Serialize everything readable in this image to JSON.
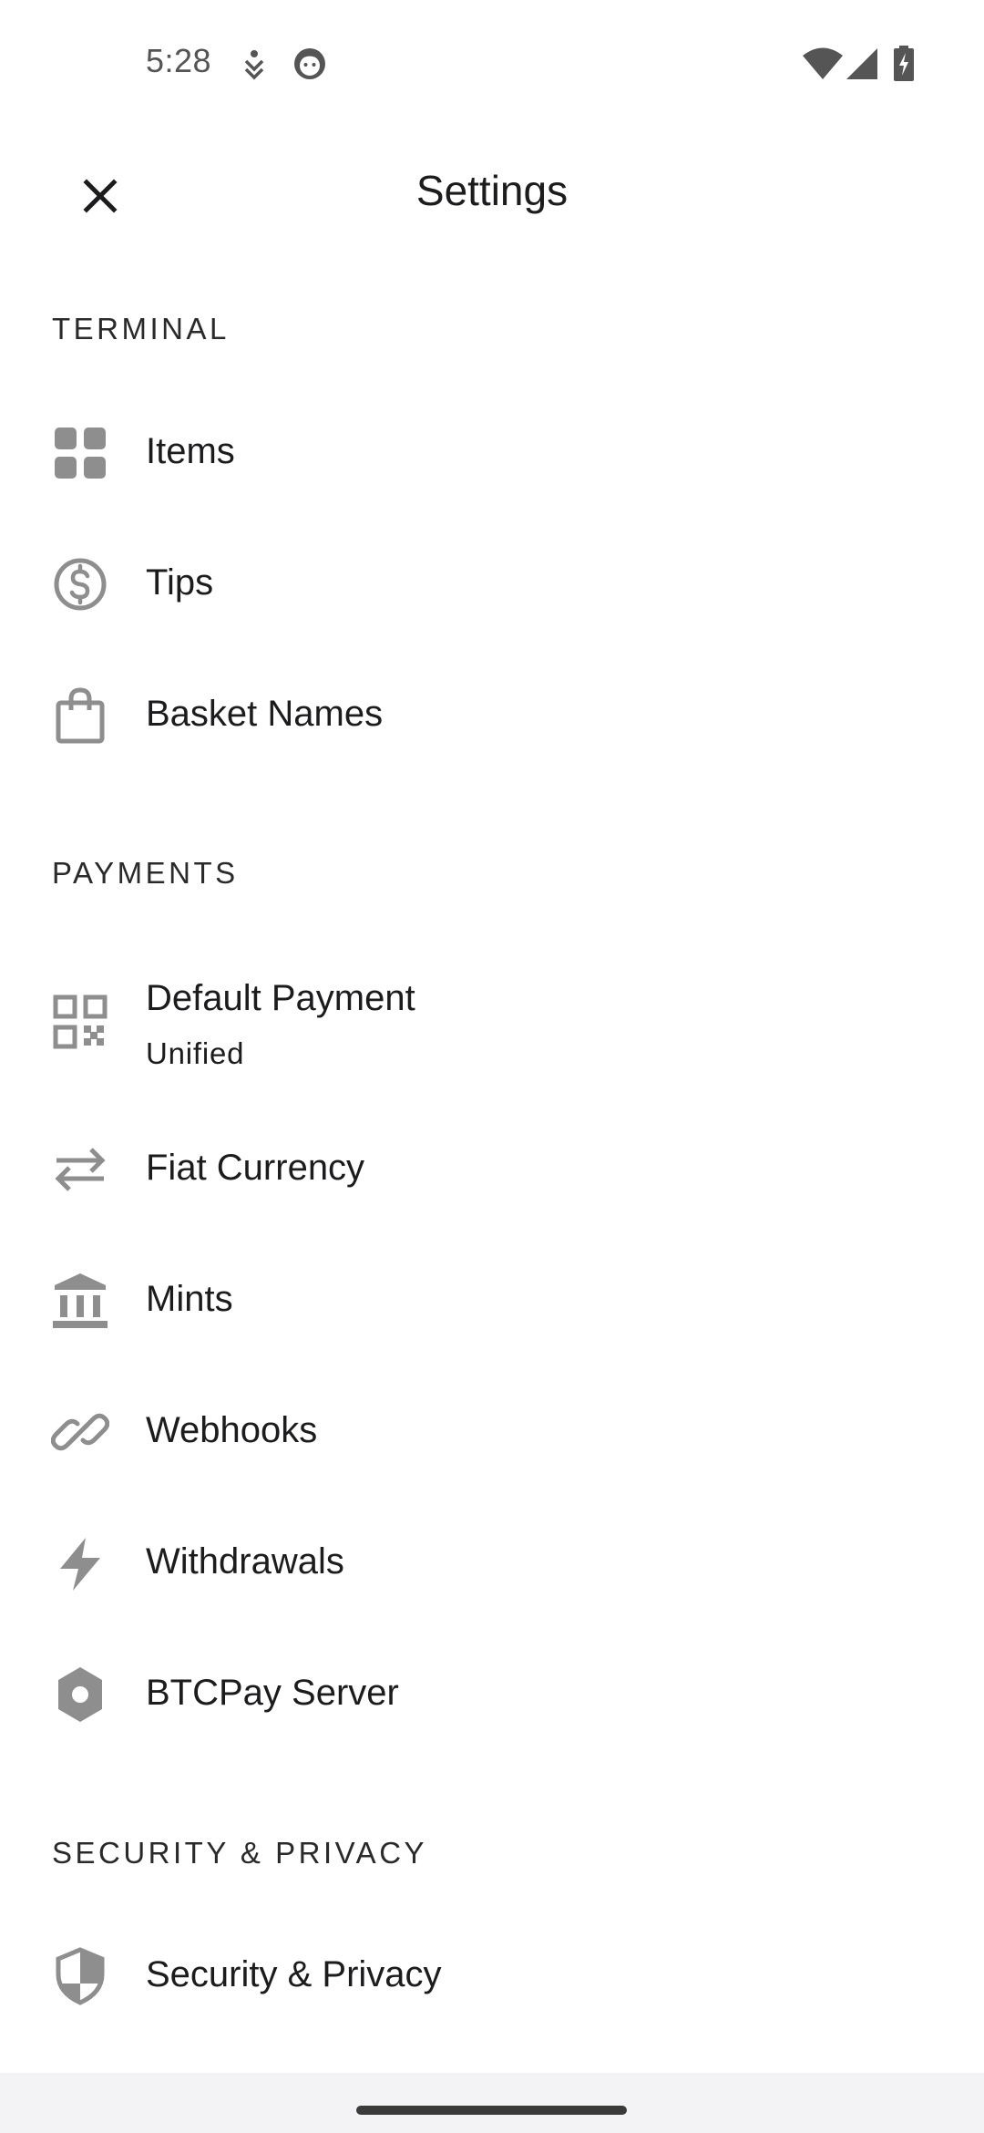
{
  "status_bar": {
    "time": "5:28",
    "icons": [
      "accessibility-icon",
      "face-icon",
      "wifi-icon",
      "cellular-signal-icon",
      "battery-charging-icon"
    ]
  },
  "header": {
    "title": "Settings",
    "close_icon": "close-icon"
  },
  "sections": {
    "terminal": {
      "title": "TERMINAL",
      "items": [
        {
          "label": "Items",
          "icon": "grid-icon"
        },
        {
          "label": "Tips",
          "icon": "dollar-circle-icon"
        },
        {
          "label": "Basket Names",
          "icon": "shopping-bag-icon"
        }
      ]
    },
    "payments": {
      "title": "PAYMENTS",
      "items": [
        {
          "label": "Default Payment",
          "value": "Unified",
          "icon": "qr-code-icon"
        },
        {
          "label": "Fiat Currency",
          "icon": "swap-arrows-icon"
        },
        {
          "label": "Mints",
          "icon": "bank-icon"
        },
        {
          "label": "Webhooks",
          "icon": "link-icon"
        },
        {
          "label": "Withdrawals",
          "icon": "lightning-icon"
        },
        {
          "label": "BTCPay Server",
          "icon": "settings-gear-icon"
        }
      ]
    },
    "security": {
      "title": "SECURITY & PRIVACY",
      "items": [
        {
          "label": "Security & Privacy",
          "icon": "shield-icon"
        }
      ]
    }
  },
  "colors": {
    "icon_gray": "#8e8e8e",
    "text": "#1c1c1e",
    "background": "#ffffff",
    "nav_bar": "#f3f3f5"
  }
}
